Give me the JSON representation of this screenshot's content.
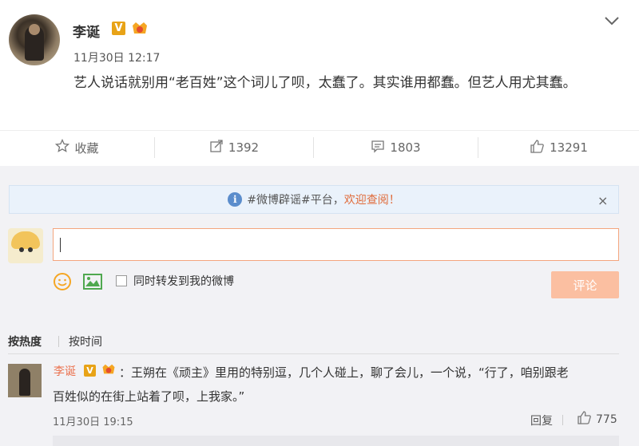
{
  "post": {
    "author": "李诞",
    "verified_badge": "V",
    "member_icon": "member-icon",
    "time": "11月30日 12:17",
    "text": "艺人说话就别用“老百姓”这个词儿了呗，太蠢了。其实谁用都蠢。但艺人用尤其蠢。"
  },
  "actions": {
    "favorite_label": "收藏",
    "repost_count": "1392",
    "comment_count": "1803",
    "like_count": "13291"
  },
  "comment_section": {
    "notice_text": "#微博辟谣#平台，",
    "notice_link": "欢迎查阅！",
    "notice_close": "×",
    "input_value": "",
    "forward_label": "同时转发到我的微博",
    "submit_label": "评论",
    "tabs": [
      "按热度",
      "按时间"
    ],
    "active_tab": "按热度"
  },
  "comments": [
    {
      "author": "李诞",
      "verified_badge": "V",
      "text_line1": "：王朔在《顽主》里用的特别逗，几个人碰上，聊了会儿，一个说，“行了，咱别跟老",
      "text_line2": "百姓似的在街上站着了呗，上我家。”",
      "time": "11月30日 19:15",
      "reply_label": "回复",
      "likes": "775"
    }
  ],
  "colors": {
    "accent": "#eb7350",
    "badge": "#e8a317",
    "submit_disabled": "#fbbfa1",
    "notice_bg": "#eaf2fb"
  }
}
